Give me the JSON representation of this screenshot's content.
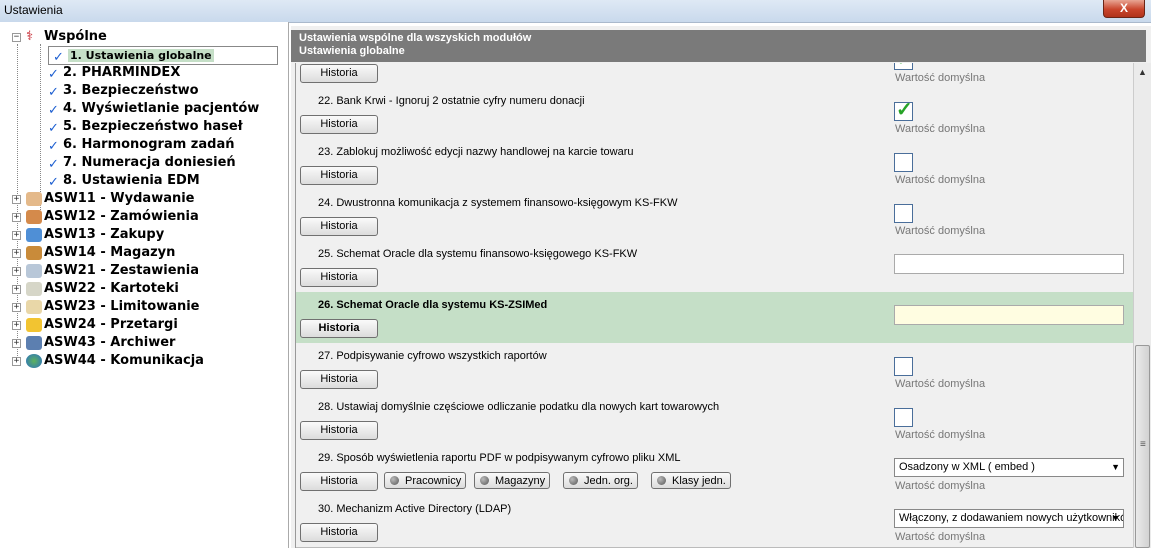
{
  "window": {
    "title": "Ustawienia",
    "close_label": "X"
  },
  "tree": {
    "root": "Wspólne",
    "children": [
      "1. Ustawienia globalne",
      "2. PHARMINDEX",
      "3. Bezpieczeństwo",
      "4. Wyświetlanie pacjentów",
      "5. Bezpieczeństwo haseł",
      "6. Harmonogram zadań",
      "7. Numeracja doniesień",
      "8. Ustawienia EDM"
    ],
    "modules": [
      "ASW11 - Wydawanie",
      "ASW12 - Zamówienia",
      "ASW13 - Zakupy",
      "ASW14 - Magazyn",
      "ASW21 - Zestawienia",
      "ASW22 - Kartoteki",
      "ASW23 - Limitowanie",
      "ASW24 - Przetargi",
      "ASW43 - Archiwer",
      "ASW44 - Komunikacja"
    ],
    "expand_plus": "+",
    "expand_minus": "−",
    "check_glyph": "✓"
  },
  "header": {
    "line1": "Ustawienia wspólne dla wszyskich modułów",
    "line2": "Ustawienia globalne"
  },
  "common": {
    "history_label": "Historia",
    "default_label": "Wartość domyślna",
    "tick": "✓",
    "dropdown_arrow": "▼",
    "scroll_up": "▲",
    "grip": "≡"
  },
  "rows": [
    {
      "label": ""
    },
    {
      "label": "22. Bank Krwi - Ignoruj 2 ostatnie cyfry numeru donacji"
    },
    {
      "label": "23. Zablokuj możliwość edycji nazwy handlowej na karcie towaru"
    },
    {
      "label": "24. Dwustronna komunikacja z systemem finansowo-księgowym KS-FKW"
    },
    {
      "label": "25. Schemat Oracle dla systemu finansowo-księgowego KS-FKW"
    },
    {
      "label": "26. Schemat Oracle dla systemu KS-ZSIMed"
    },
    {
      "label": "27. Podpisywanie cyfrowo wszystkich raportów"
    },
    {
      "label": "28. Ustawiaj domyślnie częściowe odliczanie podatku dla nowych kart towarowych"
    },
    {
      "label": "29. Sposób wyświetlenia raportu PDF w podpisywanym cyfrowo pliku XML",
      "select_value": "Osadzony w XML ( embed )",
      "extra_buttons": [
        "Pracownicy",
        "Magazyny",
        "Jedn. org.",
        "Klasy jedn."
      ]
    },
    {
      "label": "30. Mechanizm Active Directory (LDAP)",
      "select_value": "Włączony, z dodawaniem nowych użytkowników"
    }
  ],
  "colors": {
    "highlight_row": "#c5dfc7",
    "header_bg": "#7a7a7a",
    "check_green": "#27a327"
  }
}
